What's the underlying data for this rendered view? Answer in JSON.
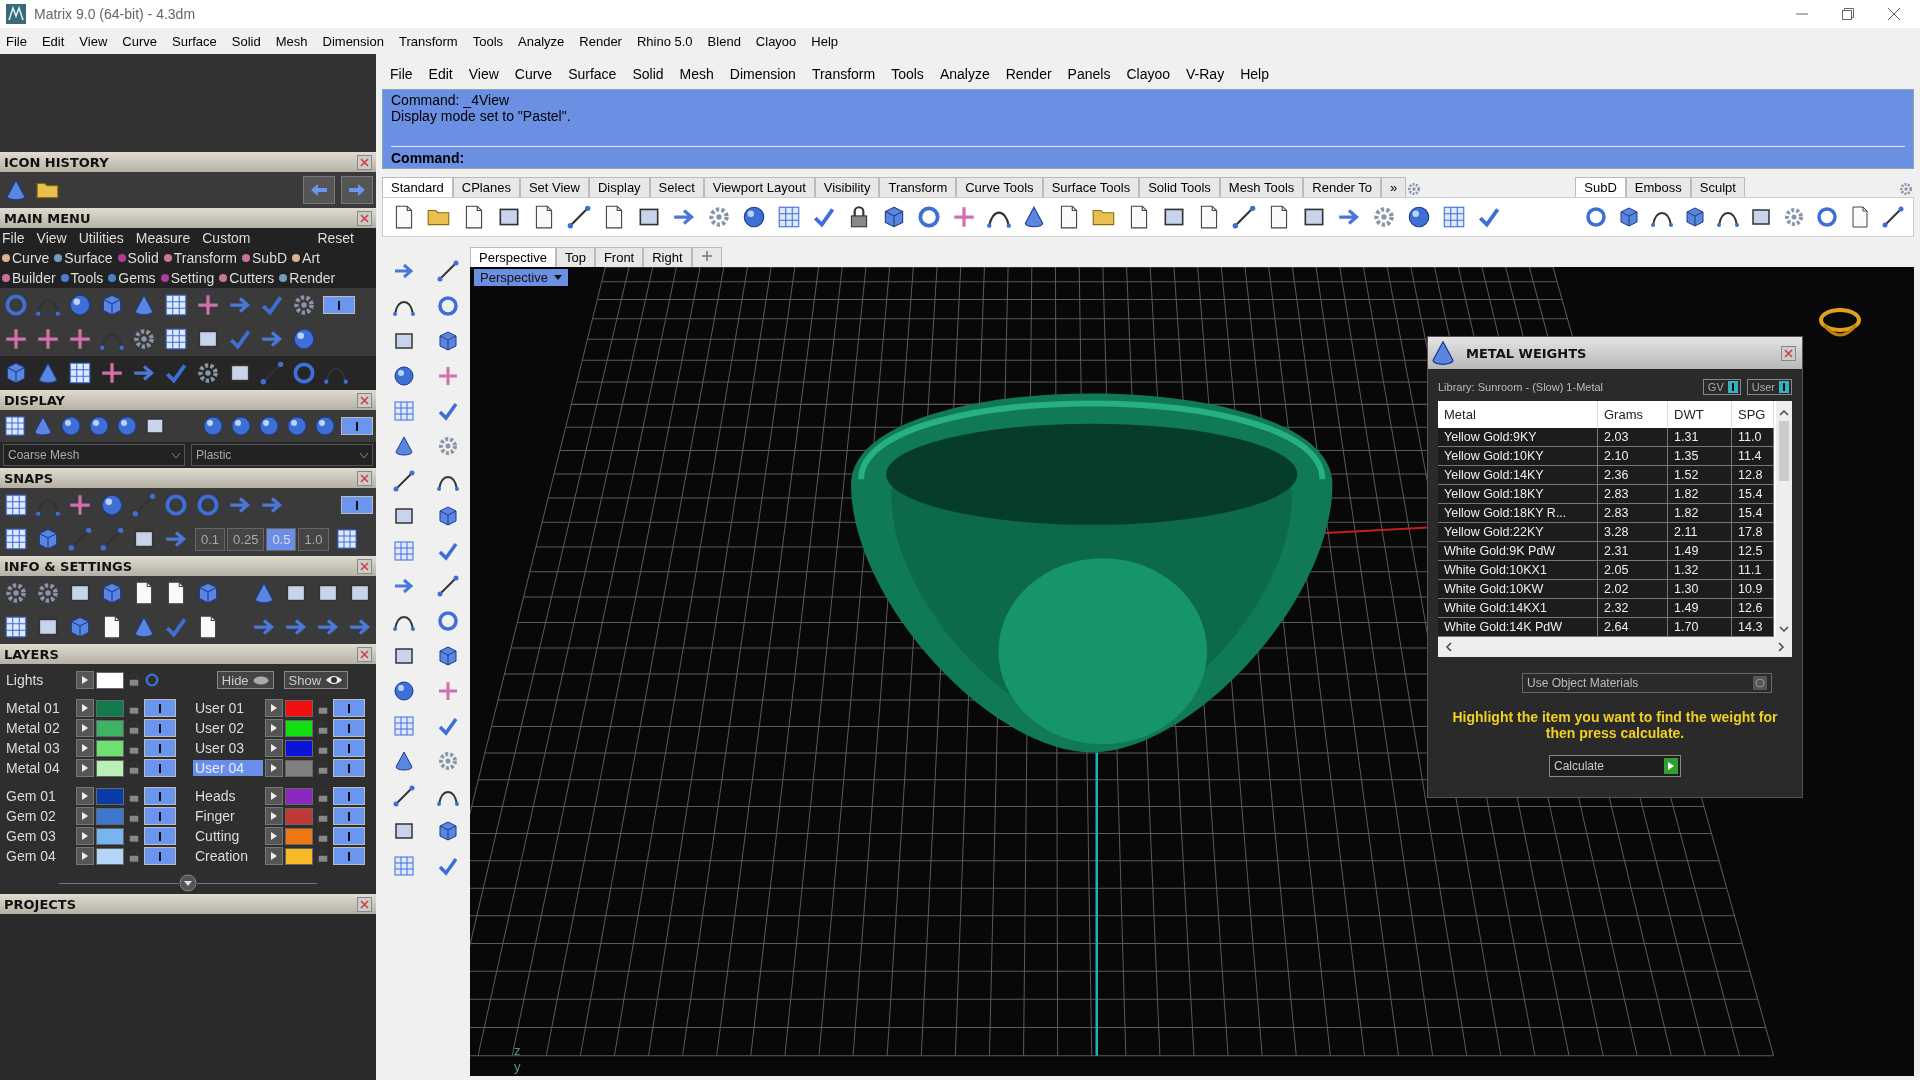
{
  "window": {
    "title": "Matrix 9.0 (64-bit) - 4.3dm"
  },
  "menu_bar": [
    "File",
    "Edit",
    "View",
    "Curve",
    "Surface",
    "Solid",
    "Mesh",
    "Dimension",
    "Transform",
    "Tools",
    "Analyze",
    "Render",
    "Rhino 5.0",
    "Blend",
    "Clayoo",
    "Help"
  ],
  "left_panel": {
    "icon_history": {
      "title": "ICON HISTORY"
    },
    "main_menu": {
      "title": "MAIN MENU",
      "menu": [
        "File",
        "View",
        "Utilities",
        "Measure",
        "Custom"
      ],
      "reset": "Reset",
      "toggle_on": true,
      "categories": [
        [
          {
            "label": "Curve",
            "color": "#d8b48c"
          },
          {
            "label": "Surface",
            "color": "#6f9fb8"
          },
          {
            "label": "Solid",
            "color": "#b03a9a"
          },
          {
            "label": "Transform",
            "color": "#c87890"
          },
          {
            "label": "SubD",
            "color": "#c8709a"
          },
          {
            "label": "Art",
            "color": "#d8b48c"
          }
        ],
        [
          {
            "label": "Builder",
            "color": "#c8709a"
          },
          {
            "label": "Tools",
            "color": "#4a7fd0"
          },
          {
            "label": "Gems",
            "color": "#4a7fd0"
          },
          {
            "label": "Setting",
            "color": "#b03a9a"
          },
          {
            "label": "Cutters",
            "color": "#c87890"
          },
          {
            "label": "Render",
            "color": "#6f9fb8"
          }
        ]
      ]
    },
    "display": {
      "title": "DISPLAY",
      "mesh": "Coarse Mesh",
      "material": "Plastic",
      "toggle_on": true
    },
    "snaps": {
      "title": "SNAPS",
      "toggle_on": true,
      "values": [
        {
          "label": "0.1",
          "selected": false
        },
        {
          "label": "0.25",
          "selected": false
        },
        {
          "label": "0.5",
          "selected": true
        },
        {
          "label": "1.0",
          "selected": false
        }
      ]
    },
    "info_settings": {
      "title": "INFO & SETTINGS"
    },
    "layers": {
      "title": "LAYERS",
      "lights": "Lights",
      "hide": "Hide",
      "show": "Show",
      "left": [
        {
          "name": "Metal 01",
          "color": "#137a4e",
          "selected": false,
          "visible": true
        },
        {
          "name": "Metal 02",
          "color": "#3cb464",
          "selected": false,
          "visible": true
        },
        {
          "name": "Metal 03",
          "color": "#6ee070",
          "selected": false,
          "visible": true
        },
        {
          "name": "Metal 04",
          "color": "#b8f0b8",
          "selected": false,
          "visible": true
        },
        {
          "name": "Gem 01",
          "color": "#0a3ca8",
          "selected": false,
          "visible": true
        },
        {
          "name": "Gem 02",
          "color": "#3c78d0",
          "selected": false,
          "visible": true
        },
        {
          "name": "Gem 03",
          "color": "#78b4f0",
          "selected": false,
          "visible": true
        },
        {
          "name": "Gem 04",
          "color": "#b4d4f8",
          "selected": false,
          "visible": true
        }
      ],
      "right": [
        {
          "name": "User 01",
          "color": "#f01010",
          "selected": false,
          "visible": true
        },
        {
          "name": "User 02",
          "color": "#10e010",
          "selected": false,
          "visible": true
        },
        {
          "name": "User 03",
          "color": "#0a14d8",
          "selected": false,
          "visible": true
        },
        {
          "name": "User 04",
          "color": "#808080",
          "selected": true,
          "visible": true
        },
        {
          "name": "Heads",
          "color": "#8c28c0",
          "selected": false,
          "visible": true
        },
        {
          "name": "Finger",
          "color": "#c03838",
          "selected": false,
          "visible": true
        },
        {
          "name": "Cutting",
          "color": "#f07814",
          "selected": false,
          "visible": true
        },
        {
          "name": "Creation",
          "color": "#f8b828",
          "selected": false,
          "visible": true
        }
      ]
    },
    "projects": {
      "title": "PROJECTS"
    }
  },
  "rhino": {
    "menu": [
      "File",
      "Edit",
      "View",
      "Curve",
      "Surface",
      "Solid",
      "Mesh",
      "Dimension",
      "Transform",
      "Tools",
      "Analyze",
      "Render",
      "Panels",
      "Clayoo",
      "V-Ray",
      "Help"
    ],
    "command_history": [
      "Command: _4View",
      "Display mode set to \"Pastel\"."
    ],
    "command_prompt": "Command:",
    "toolbar_tabs": [
      {
        "label": "Standard",
        "selected": true
      },
      {
        "label": "CPlanes",
        "selected": false
      },
      {
        "label": "Set View",
        "selected": false
      },
      {
        "label": "Display",
        "selected": false
      },
      {
        "label": "Select",
        "selected": false
      },
      {
        "label": "Viewport Layout",
        "selected": false
      },
      {
        "label": "Visibility",
        "selected": false
      },
      {
        "label": "Transform",
        "selected": false
      },
      {
        "label": "Curve Tools",
        "selected": false
      },
      {
        "label": "Surface Tools",
        "selected": false
      },
      {
        "label": "Solid Tools",
        "selected": false
      },
      {
        "label": "Mesh Tools",
        "selected": false
      },
      {
        "label": "Render To",
        "selected": false
      }
    ],
    "more": "»",
    "side_tabs": [
      {
        "label": "SubD",
        "selected": true
      },
      {
        "label": "Emboss",
        "selected": false
      },
      {
        "label": "Sculpt",
        "selected": false
      }
    ],
    "viewport_tabs": [
      {
        "label": "Perspective",
        "selected": true
      },
      {
        "label": "Top",
        "selected": false
      },
      {
        "label": "Front",
        "selected": false
      },
      {
        "label": "Right",
        "selected": false
      }
    ],
    "viewport_label": "Perspective",
    "axis_labels": [
      "z",
      "y"
    ]
  },
  "metal_weights": {
    "title": "METAL WEIGHTS",
    "library": "Library: Sunroom - (Slow) 1-Metal",
    "toggles": [
      {
        "label": "GV",
        "on": true
      },
      {
        "label": "User",
        "on": true
      }
    ],
    "columns": [
      "Metal",
      "Grams",
      "DWT",
      "SPG"
    ],
    "rows": [
      [
        "Yellow Gold:9KY",
        "2.03",
        "1.31",
        "11.0"
      ],
      [
        "Yellow Gold:10KY",
        "2.10",
        "1.35",
        "11.4"
      ],
      [
        "Yellow Gold:14KY",
        "2.36",
        "1.52",
        "12.8"
      ],
      [
        "Yellow Gold:18KY",
        "2.83",
        "1.82",
        "15.4"
      ],
      [
        "Yellow Gold:18KY R...",
        "2.83",
        "1.82",
        "15.4"
      ],
      [
        "Yellow Gold:22KY",
        "3.28",
        "2.11",
        "17.8"
      ],
      [
        "White Gold:9K PdW",
        "2.31",
        "1.49",
        "12.5"
      ],
      [
        "White Gold:10KX1",
        "2.05",
        "1.32",
        "11.1"
      ],
      [
        "White Gold:10KW",
        "2.02",
        "1.30",
        "10.9"
      ],
      [
        "White Gold:14KX1",
        "2.32",
        "1.49",
        "12.6"
      ],
      [
        "White Gold:14K PdW",
        "2.64",
        "1.70",
        "14.3"
      ]
    ],
    "use_object_materials": {
      "label": "Use Object Materials",
      "checked": false
    },
    "instruction": "Highlight the item you want to find the weight for then press calculate.",
    "calculate": "Calculate"
  }
}
